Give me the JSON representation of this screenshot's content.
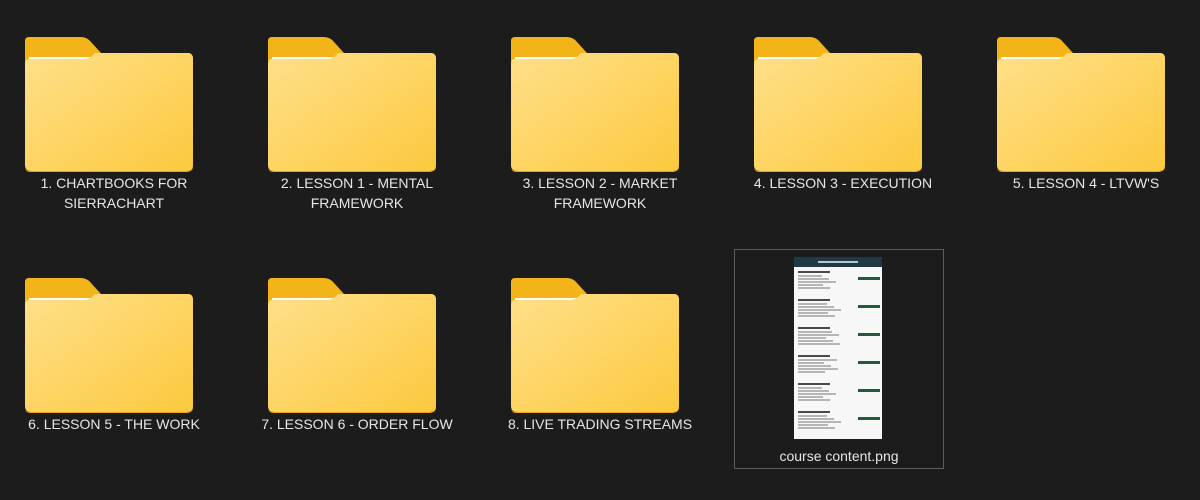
{
  "items": [
    {
      "type": "folder",
      "label": "1. CHARTBOOKS FOR\nSIERRACHART"
    },
    {
      "type": "folder",
      "label": "2. LESSON 1 - MENTAL\nFRAMEWORK"
    },
    {
      "type": "folder",
      "label": "3. LESSON 2 - MARKET\nFRAMEWORK"
    },
    {
      "type": "folder",
      "label": "4. LESSON 3 - EXECUTION"
    },
    {
      "type": "folder",
      "label": "5. LESSON 4 - LTVW'S"
    },
    {
      "type": "folder",
      "label": "6. LESSON 5 - THE WORK"
    },
    {
      "type": "folder",
      "label": "7. LESSON 6 - ORDER FLOW"
    },
    {
      "type": "folder",
      "label": "8. LIVE TRADING STREAMS"
    },
    {
      "type": "image",
      "label": "course content.png",
      "selected": true
    }
  ],
  "colors": {
    "background": "#1c1c1c",
    "folder_back": "#f2b418",
    "folder_front": "#ffd76b",
    "folder_paper": "#f4f4f4",
    "text": "#e6e6e6",
    "selection_border": "#5d5d5d",
    "thumbnail_header": "#1f3a44",
    "thumbnail_button": "#235a3e"
  },
  "icons": {
    "folder": "folder-icon",
    "image": "image-thumbnail"
  }
}
